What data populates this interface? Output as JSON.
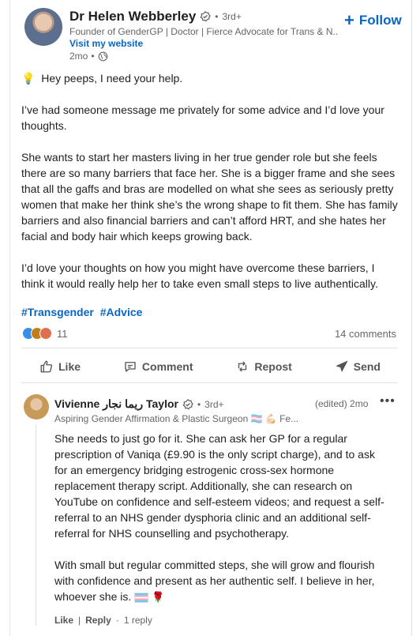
{
  "post": {
    "author": {
      "name": "Dr Helen Webberley",
      "degree": "3rd+",
      "headline": "Founder of GenderGP | Doctor | Fierce Advocate for Trans & N...",
      "website_label": "Visit my website",
      "time": "2mo"
    },
    "follow_label": "Follow",
    "intro": "Hey peeps, I need your help.",
    "paragraphs": [
      "I’ve had someone message me privately for some advice and I’d love your thoughts.",
      "She wants to start her masters living in her true gender role but she feels there are so many barriers that face her. She is a bigger frame and she sees that all the gaffs and bras are modelled on what she sees as seriously pretty women that make her think she’s the wrong shape to fit them. She has family barriers and also financial barriers and can’t afford HRT, and she hates her facial and body hair which keeps growing back.",
      "I’d love your thoughts on how you might have overcome these barriers, I think it would really help her to take even small steps to live authentically."
    ],
    "hashtags": [
      "#Transgender",
      "#Advice"
    ],
    "reaction_count": "11",
    "comments_count": "14 comments"
  },
  "actions": {
    "like": "Like",
    "comment": "Comment",
    "repost": "Repost",
    "send": "Send"
  },
  "comment": {
    "author_name": "Vivienne ريما نجار Taylor",
    "degree": "3rd+",
    "headline": "Aspiring Gender Affirmation & Plastic Surgeon 🏳️‍⚧️ 💪🏻 Fe...",
    "time": "(edited) 2mo",
    "paragraphs": [
      "She needs to just go for it. She can ask her GP for a regular prescription of Vaniqa (£9.90 is the only script charge), and to ask for an emergency bridging estrogenic cross-sex hormone replacement therapy script. Additionally, she can research on YouTube on confidence and self-esteem videos; and request a self-referral to an NHS gender dysphoria clinic and an additional self-referral for NHS counselling and psychotherapy.",
      "With small but regular committed steps, she will grow and flourish with confidence and present as her authentic self. I believe in her, whoever she is."
    ],
    "like_label": "Like",
    "reply_label": "Reply",
    "replies": "1 reply"
  },
  "colors": {
    "link": "#0a66c2",
    "muted": "#666666",
    "text": "#1f1f1f"
  }
}
